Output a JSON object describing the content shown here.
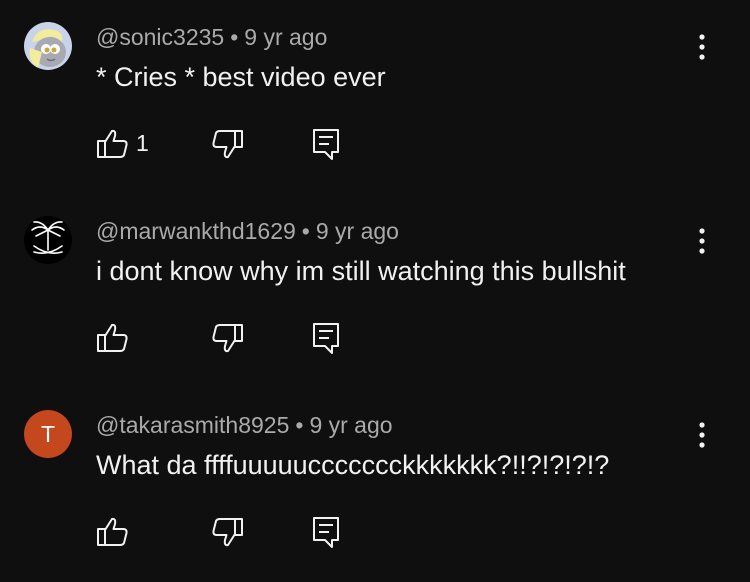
{
  "comments": [
    {
      "handle": "@sonic3235",
      "time": "9 yr ago",
      "text": "* Cries * best video ever",
      "likes": "1",
      "avatar": "pony-avatar"
    },
    {
      "handle": "@marwankthd1629",
      "time": "9 yr ago",
      "text": "i dont know why im still watching this bullshit",
      "likes": "",
      "avatar": "palm-swords-emblem-avatar"
    },
    {
      "handle": "@takarasmith8925",
      "time": "9 yr ago",
      "text": "What da ffffuuuuuccccccckkkkkkk?!!?!?!?!?",
      "likes": "",
      "avatar": "letter-avatar",
      "avatar_letter": "T",
      "avatar_color": "#c4471e"
    }
  ],
  "separator": "•",
  "icons": {
    "like": "thumbs-up-icon",
    "dislike": "thumbs-down-icon",
    "reply": "reply-icon",
    "more": "more-vert-icon"
  },
  "colors": {
    "background": "#0f0f0f",
    "text_primary": "#f1f1f1",
    "text_secondary": "#aaaaaa"
  }
}
